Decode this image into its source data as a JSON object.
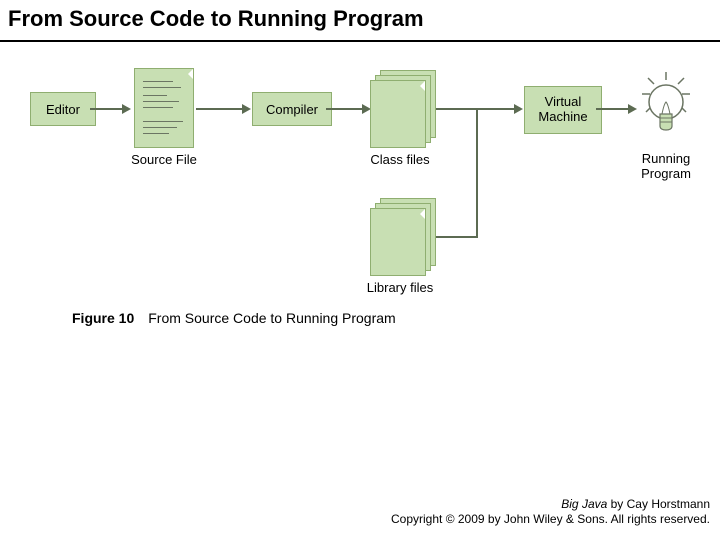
{
  "title": "From Source Code to Running Program",
  "nodes": {
    "editor": "Editor",
    "source_file": "Source File",
    "compiler": "Compiler",
    "class_files": "Class files",
    "library_files": "Library files",
    "virtual_machine": "Virtual\nMachine",
    "running_program": "Running\nProgram"
  },
  "caption": {
    "prefix": "Figure 10",
    "text": "From Source Code to Running Program"
  },
  "footer": {
    "line1_italic": "Big Java",
    "line1_rest": " by Cay Horstmann",
    "line2": "Copyright © 2009 by John Wiley & Sons. All rights reserved."
  }
}
